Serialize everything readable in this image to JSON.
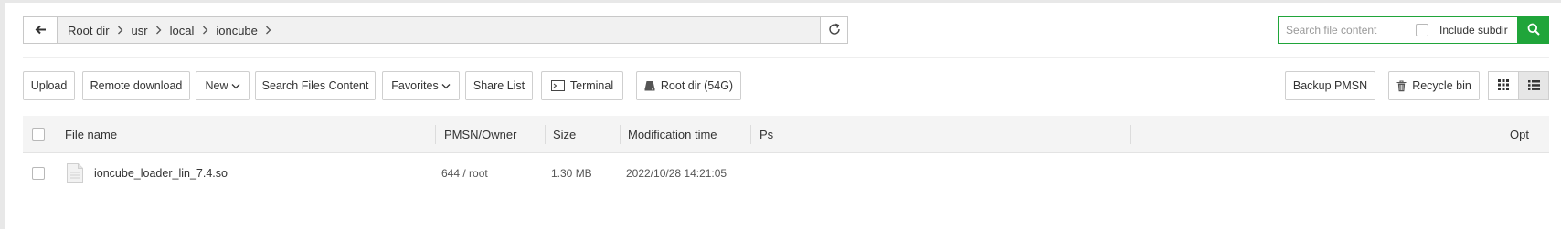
{
  "breadcrumbs": [
    "Root dir",
    "usr",
    "local",
    "ioncube"
  ],
  "search": {
    "placeholder": "Search file content",
    "include_subdir_label": "Include subdir"
  },
  "toolbar": {
    "upload": "Upload",
    "remote_download": "Remote download",
    "new": "New",
    "search_files_content": "Search Files Content",
    "favorites": "Favorites",
    "share_list": "Share List",
    "terminal": "Terminal",
    "root_dir": "Root dir (54G)",
    "backup_pmsn": "Backup PMSN",
    "recycle_bin": "Recycle bin"
  },
  "table": {
    "headers": {
      "file_name": "File name",
      "pmsn_owner": "PMSN/Owner",
      "size": "Size",
      "modification_time": "Modification time",
      "ps": "Ps",
      "opt": "Opt"
    },
    "rows": [
      {
        "name": "ioncube_loader_lin_7.4.so",
        "pmsn_owner": "644 / root",
        "size": "1.30 MB",
        "modified": "2022/10/28 14:21:05",
        "ps": ""
      }
    ]
  },
  "colors": {
    "accent": "#20a53a",
    "header_bg": "#f4f4f4",
    "path_bg": "#f1f1f1"
  },
  "icons": [
    "back-arrow-icon",
    "chevron-right-icon",
    "refresh-icon",
    "search-icon",
    "terminal-icon",
    "disk-icon",
    "trash-icon",
    "grid-view-icon",
    "list-view-icon",
    "file-icon",
    "caret-down-icon"
  ]
}
